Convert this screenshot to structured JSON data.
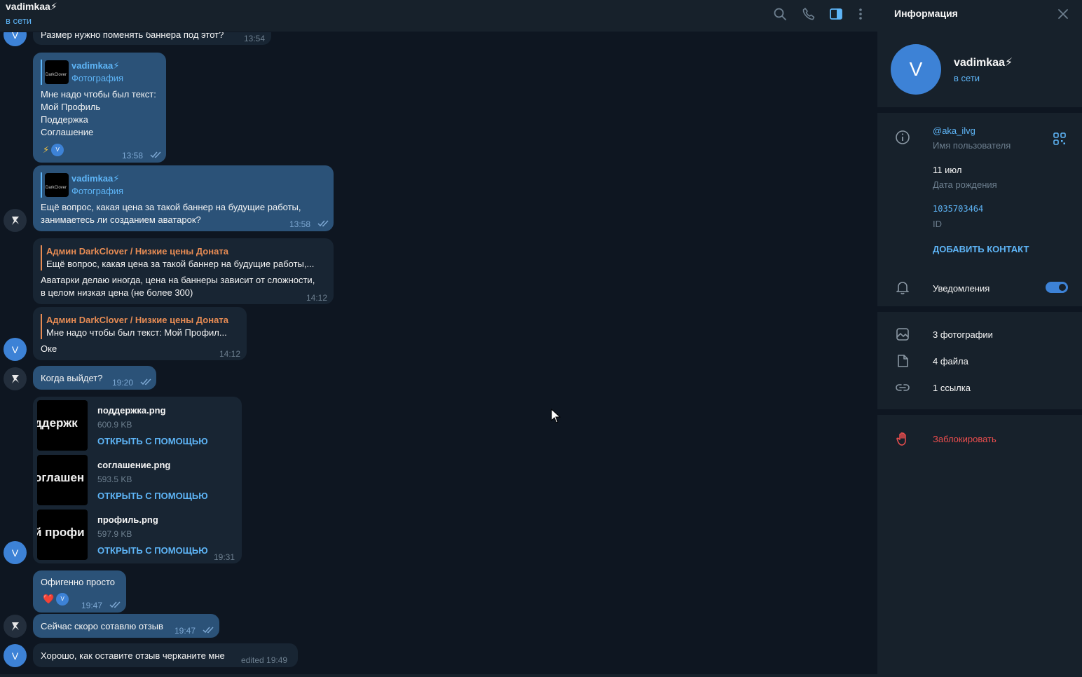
{
  "header": {
    "title": "vadimkaa⚡",
    "status": "в сети"
  },
  "icons": {
    "search": "search-icon",
    "call": "phone-icon",
    "sidebar": "sidebar-toggle-icon",
    "more": "more-vertical-icon"
  },
  "colors": {
    "accent": "#5eb5f7",
    "outgoing_bubble": "#2b5278",
    "incoming_bubble": "#182533",
    "reply_orange": "#e88c54",
    "block_red": "#ec4e4e"
  },
  "messages": {
    "m1": {
      "text": "Размер нужно поменять баннера под этот?",
      "time": "13:54"
    },
    "m2": {
      "reply_name": "vadimkaa⚡",
      "reply_sub": "Фотография",
      "reply_thumb_text": "DarkClover",
      "lines": [
        "Мне надо чтобы был текст:",
        "Мой Профиль",
        "Поддержка",
        "Соглашение"
      ],
      "reaction": "⚡",
      "reaction_avatar": "V",
      "time": "13:58"
    },
    "m3": {
      "reply_name": "vadimkaa⚡",
      "reply_sub": "Фотография",
      "reply_thumb_text": "DarkClover",
      "lines": [
        "Ещё вопрос, какая цена за такой баннер на будущие работы,",
        "занимаетесь ли созданием аватарок?"
      ],
      "time": "13:58"
    },
    "m4": {
      "reply_name": "Админ DarkClover / Низкие цены Доната",
      "reply_text": "Ещё вопрос, какая цена за такой баннер на будущие работы,...",
      "lines": [
        "Аватарки делаю иногда, цена на баннеры зависит от сложности,",
        "в целом низкая цена (не более 300)"
      ],
      "time": "14:12"
    },
    "m5": {
      "reply_name": "Админ DarkClover / Низкие цены Доната",
      "reply_text": "Мне надо чтобы был текст: Мой Профил...",
      "text": "Оке",
      "time": "14:12"
    },
    "m6": {
      "text": "Когда выйдет?",
      "time": "19:20"
    },
    "m7": {
      "files": [
        {
          "name": "поддержка.png",
          "size": "600.9 KB",
          "action": "ОТКРЫТЬ С ПОМОЩЬЮ",
          "thumb_text": "ддержк"
        },
        {
          "name": "соглашение.png",
          "size": "593.5 KB",
          "action": "ОТКРЫТЬ С ПОМОЩЬЮ",
          "thumb_text": "оглашен"
        },
        {
          "name": "профиль.png",
          "size": "597.9 KB",
          "action": "ОТКРЫТЬ С ПОМОЩЬЮ",
          "thumb_text": "й профи"
        }
      ],
      "time": "19:31"
    },
    "m8": {
      "text": "Офигенно просто",
      "reaction": "❤️",
      "reaction_avatar": "V",
      "time": "19:47"
    },
    "m9": {
      "text": "Сейчас скоро сотавлю отзыв",
      "time": "19:47"
    },
    "m10": {
      "text": "Хорошо, как оставите отзыв черканите мне",
      "time": "edited 19:49"
    }
  },
  "avatars": {
    "contact_letter": "V"
  },
  "panel": {
    "title": "Информация",
    "avatar_letter": "V",
    "name": "vadimkaa⚡",
    "status": "в сети",
    "username": "@aka_ilvg",
    "username_label": "Имя пользователя",
    "birthday": "11 июл",
    "birthday_label": "Дата рождения",
    "id": "1035703464",
    "id_label": "ID",
    "add_contact": "ДОБАВИТЬ КОНТАКТ",
    "notifications": "Уведомления",
    "notifications_on": true,
    "photos": "3 фотографии",
    "files": "4 файла",
    "links": "1 ссылка",
    "block": "Заблокировать"
  }
}
